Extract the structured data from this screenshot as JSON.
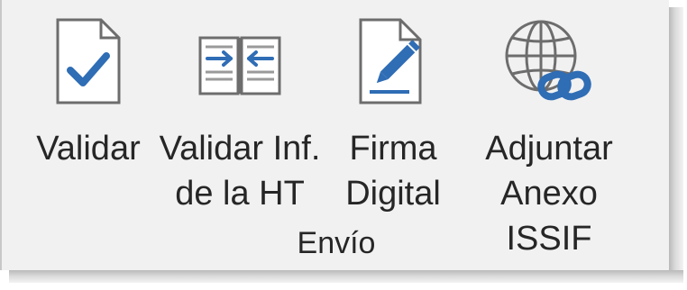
{
  "ribbon_group": {
    "label": "Envío",
    "buttons": [
      {
        "label": "Validar",
        "icon": "document-checkmark-icon"
      },
      {
        "label": "Validar Inf.\nde la HT",
        "icon": "book-arrows-icon"
      },
      {
        "label": "Firma\nDigital",
        "icon": "document-pen-signature-icon"
      },
      {
        "label": "Adjuntar\nAnexo ISSIF",
        "icon": "globe-link-icon"
      }
    ]
  },
  "colors": {
    "panel_background": "#f1f1f1",
    "icon_blue": "#2f6db5",
    "icon_gray": "#6d6d6d",
    "text": "#262626"
  }
}
